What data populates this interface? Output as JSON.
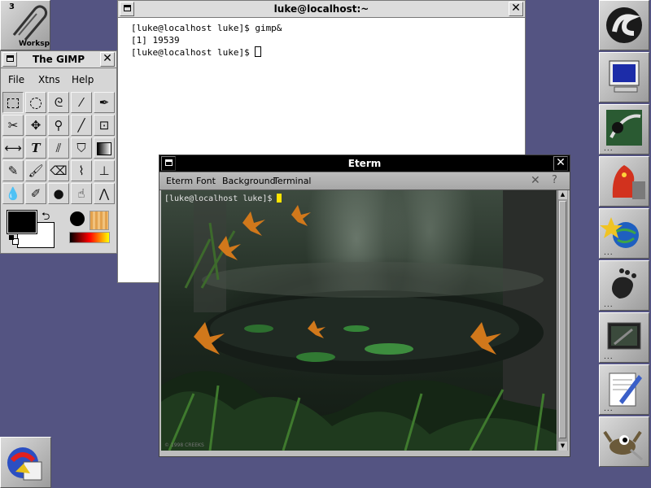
{
  "workspace": {
    "number": "3",
    "label": "Worksp"
  },
  "xterm": {
    "title": "luke@localhost:~",
    "lines": [
      "[luke@localhost luke]$ gimp&",
      "[1] 19539",
      "[luke@localhost luke]$ "
    ]
  },
  "gimp": {
    "title": "The GIMP",
    "menus": [
      "File",
      "Xtns",
      "Help"
    ],
    "fg_color": "#000000",
    "bg_color": "#ffffff"
  },
  "eterm": {
    "title": "Eterm",
    "menus": [
      "Eterm",
      "Font",
      "Background",
      "Terminal"
    ],
    "prompt": "[luke@localhost luke]$ ",
    "watermark": "© 1998 CREEKS"
  },
  "dock": {
    "icons": [
      "debian-swirl-icon",
      "monitor-icon",
      "gimp-paint-icon",
      "dragon-icon",
      "globe-star-icon",
      "gnome-foot-icon",
      "display-settings-icon",
      "text-editor-icon",
      "wilber-gimp-icon"
    ]
  },
  "colors": {
    "desktop": "#545482",
    "cursor": "#ffe400"
  }
}
